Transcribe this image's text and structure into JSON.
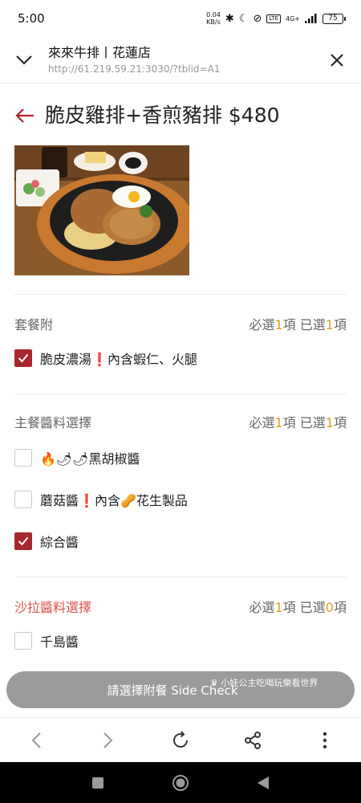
{
  "status_bar": {
    "time": "5:00",
    "net_speed_value": "0.04",
    "net_speed_unit": "KB/s",
    "network": "4G+",
    "lte": "LTE",
    "battery": "75"
  },
  "browser_header": {
    "title": "來來牛排丨花蓮店",
    "url": "http://61.219.59.21:3030/?tblid=A1"
  },
  "product": {
    "title": "脆皮雞排+香煎豬排 $480"
  },
  "sections": [
    {
      "title": "套餐附",
      "req_prefix": "必選",
      "required": "1",
      "req_mid": "項 已選",
      "selected": "1",
      "req_suffix": "項",
      "options": [
        {
          "label_before": "脆皮濃湯",
          "mark": "❗",
          "label_after": "內含蝦仁、火腿",
          "checked": true
        }
      ]
    },
    {
      "title": "主餐醬料選擇",
      "req_prefix": "必選",
      "required": "1",
      "req_mid": "項 已選",
      "selected": "1",
      "req_suffix": "項",
      "options": [
        {
          "label_before": "🔥🌶🌶黑胡椒醬",
          "mark": "",
          "label_after": "",
          "checked": false
        },
        {
          "label_before": "蘑菇醬",
          "mark": "❗",
          "label_after": "內含🥜花生製品",
          "checked": false
        },
        {
          "label_before": "綜合醬",
          "mark": "",
          "label_after": "",
          "checked": true
        }
      ]
    },
    {
      "title": "沙拉醬料選擇",
      "req_prefix": "必選",
      "required": "1",
      "req_mid": "項 已選",
      "selected": "0",
      "req_suffix": "項",
      "options": [
        {
          "label_before": "千島醬",
          "mark": "",
          "label_after": "",
          "checked": false
        }
      ]
    }
  ],
  "cta": {
    "label": "請選擇附餐 Side Check"
  },
  "watermark": "♛ 小娃公主吃喝玩樂看世界",
  "icons": {
    "chevron_down": "chevron-down-icon",
    "close": "close-icon",
    "back_arrow": "back-arrow-icon",
    "nav_back": "chevron-left-icon",
    "nav_forward": "chevron-right-icon",
    "reload": "reload-icon",
    "share": "share-icon",
    "more": "more-vert-icon"
  },
  "colors": {
    "brand_red": "#a8262d",
    "required_count": "#e0a020",
    "salad_section_title": "#d9534f",
    "cta_bg": "#9b9b9b"
  }
}
